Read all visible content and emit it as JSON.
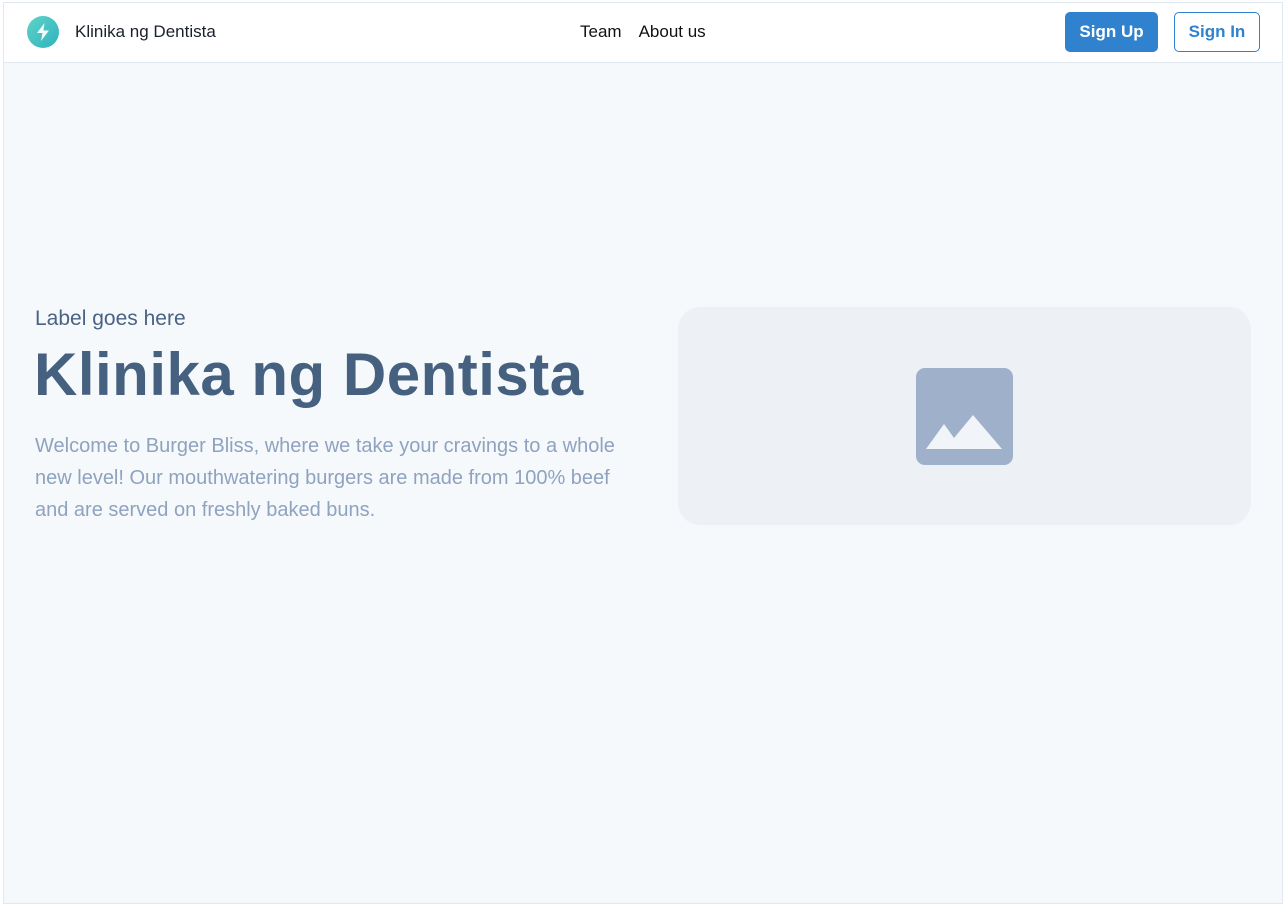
{
  "navbar": {
    "brand": "Klinika ng Dentista",
    "logo_icon": "lightning-bolt-icon",
    "links": [
      "Team",
      "About us"
    ],
    "sign_up_label": "Sign Up",
    "sign_in_label": "Sign In"
  },
  "hero": {
    "label": "Label goes here",
    "title": "Klinika ng Dentista",
    "description": "Welcome to Burger Bliss, where we take your cravings to a whole new level! Our mouthwatering burgers are made from 100% beef and are served on freshly baked buns.",
    "image_icon": "image-placeholder-icon"
  },
  "colors": {
    "primary": "#3182ce",
    "title": "#46607f",
    "body_text": "#8fa2be",
    "background": "#f5f9fc",
    "card": "#edf1f6"
  }
}
